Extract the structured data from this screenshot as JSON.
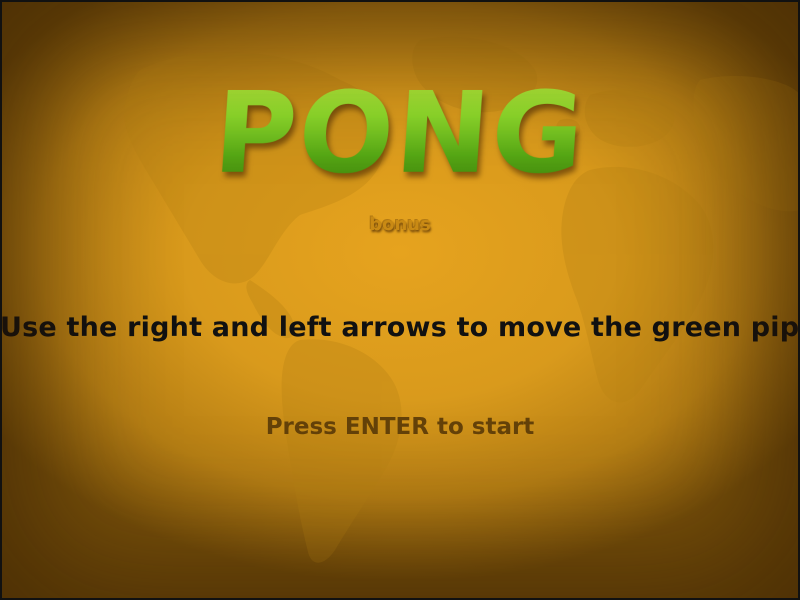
{
  "game": {
    "title": "PONG",
    "subtitle": "bonus",
    "instructions": "Use the right and left arrows to move the green pipe",
    "start_prompt": "Press ENTER to start"
  },
  "colors": {
    "background": "#d99a1c",
    "title_green": "#8bd82a",
    "instructions_text": "#111111",
    "start_text": "#5a3a08"
  },
  "icons": {
    "background": "world-map"
  }
}
